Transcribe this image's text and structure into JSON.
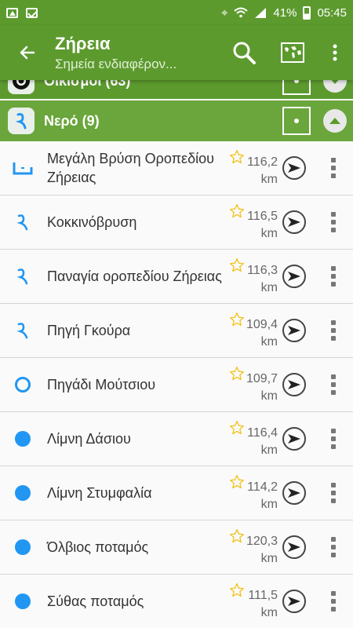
{
  "status": {
    "battery": "41%",
    "time": "05:45"
  },
  "appbar": {
    "title": "Ζήρεια",
    "subtitle": "Σημεία ενδιαφέρον..."
  },
  "categories": [
    {
      "label": "Οικισμοί (63)"
    },
    {
      "label": "Νερό (9)"
    }
  ],
  "colors": {
    "primary": "#5c9a2e",
    "icon_blue": "#2196f3",
    "star": "#f2c31a"
  },
  "items": [
    {
      "name": "Μεγάλη Βρύση Οροπεδίου Ζήρειας",
      "dist": "116,2",
      "unit": "km",
      "icon": "fountain-icon"
    },
    {
      "name": "Κοκκινόβρυση",
      "dist": "116,5",
      "unit": "km",
      "icon": "spring-icon"
    },
    {
      "name": "Παναγία οροπεδίου Ζήρειας",
      "dist": "116,3",
      "unit": "km",
      "icon": "spring-icon"
    },
    {
      "name": "Πηγή Γκούρα",
      "dist": "109,4",
      "unit": "km",
      "icon": "spring-icon"
    },
    {
      "name": "Πηγάδι Μούτσιου",
      "dist": "109,7",
      "unit": "km",
      "icon": "well-icon"
    },
    {
      "name": "Λίμνη Δάσιου",
      "dist": "116,4",
      "unit": "km",
      "icon": "lake-icon"
    },
    {
      "name": "Λίμνη Στυμφαλία",
      "dist": "114,2",
      "unit": "km",
      "icon": "lake-icon"
    },
    {
      "name": "Όλβιος ποταμός",
      "dist": "120,3",
      "unit": "km",
      "icon": "lake-icon"
    },
    {
      "name": "Σύθας ποταμός",
      "dist": "111,5",
      "unit": "km",
      "icon": "lake-icon"
    }
  ]
}
